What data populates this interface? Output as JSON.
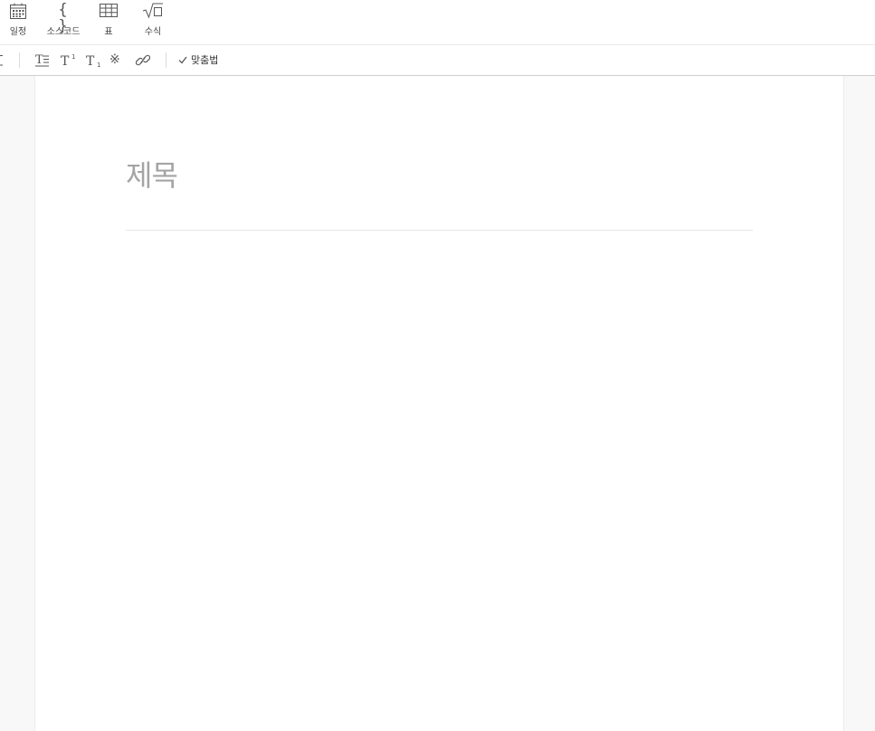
{
  "insert_toolbar": {
    "items": [
      {
        "label": "일정",
        "icon": "calendar-icon"
      },
      {
        "label": "소스코드",
        "icon": "braces-icon",
        "glyph": "{ }"
      },
      {
        "label": "표",
        "icon": "table-icon"
      },
      {
        "label": "수식",
        "icon": "sqrt-icon"
      }
    ]
  },
  "format_toolbar": {
    "items": [
      {
        "icon": "text-style-icon",
        "glyph": "T"
      },
      {
        "icon": "superscript-icon",
        "glyph": "T"
      },
      {
        "icon": "subscript-icon",
        "glyph": "T"
      },
      {
        "icon": "special-char-icon",
        "glyph": "※"
      },
      {
        "icon": "link-icon"
      }
    ],
    "spellcheck_label": "맞춤법"
  },
  "editor": {
    "title_placeholder": "제목",
    "body_text": ""
  },
  "colors": {
    "placeholder": "#a4a4a4",
    "toolbar_icon": "#555555",
    "page_bg": "#ffffff",
    "gutter_bg": "#f8f8f8"
  }
}
